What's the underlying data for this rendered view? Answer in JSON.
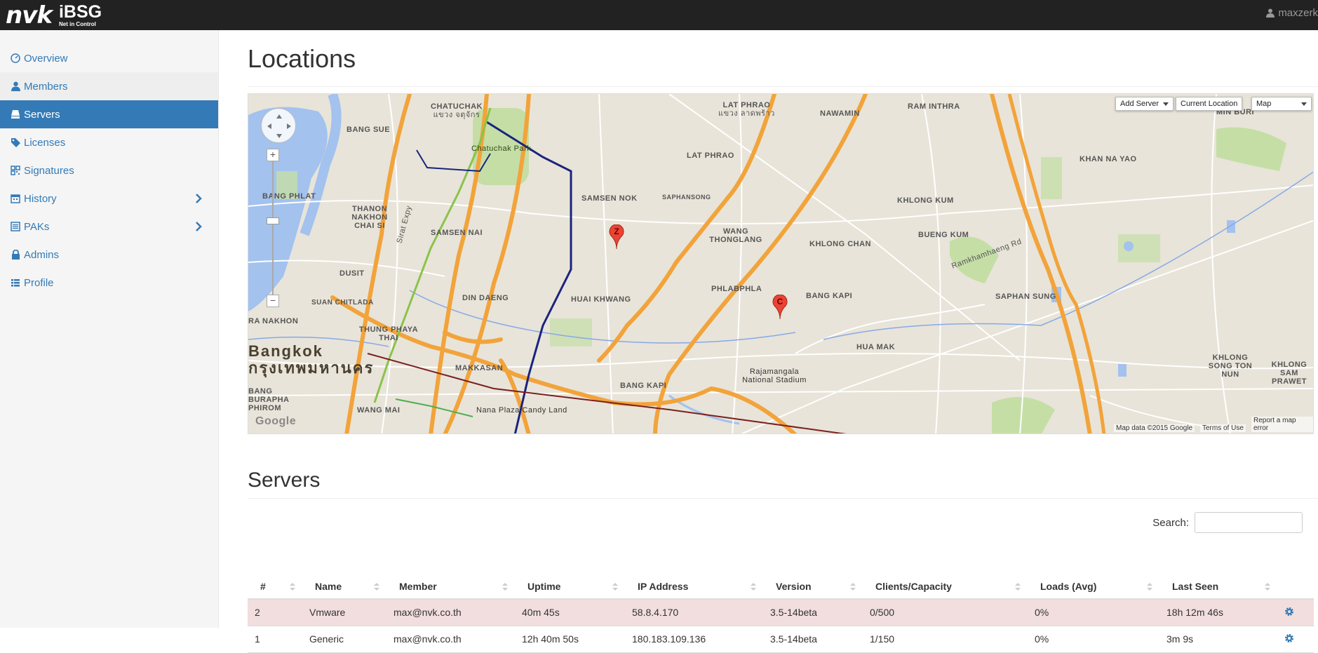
{
  "app": {
    "logo_mark": "nvk",
    "brand": "iBSG",
    "tagline": "Net in Control",
    "user": "maxzerk"
  },
  "sidebar": {
    "items": [
      {
        "label": "Overview",
        "icon": "dashboard-icon"
      },
      {
        "label": "Members",
        "icon": "user-icon"
      },
      {
        "label": "Servers",
        "icon": "server-icon"
      },
      {
        "label": "Licenses",
        "icon": "tags-icon"
      },
      {
        "label": "Signatures",
        "icon": "qrcode-icon"
      },
      {
        "label": "History",
        "icon": "calendar-icon"
      },
      {
        "label": "PAKs",
        "icon": "list-alt-icon"
      },
      {
        "label": "Admins",
        "icon": "lock-icon"
      },
      {
        "label": "Profile",
        "icon": "list-icon"
      }
    ],
    "active": "Servers"
  },
  "locations": {
    "title": "Locations",
    "map": {
      "controls": {
        "add_server": "Add Server",
        "current_location": "Current Location",
        "map_type": "Map"
      },
      "footer": {
        "attribution": "Map data ©2015 Google",
        "terms": "Terms of Use",
        "report": "Report a map error"
      },
      "watermark": "Google",
      "markers": [
        "Z",
        "C"
      ],
      "labels": {
        "chatuchak": "CHATUCHAK",
        "chatuchak_th": "แขวง จตุจักร",
        "lat_phrao": "LAT PHRAO",
        "lat_phrao_th": "แขวง ลาดพร้าว",
        "nawamin": "NAWAMIN",
        "ram_inthra": "RAM INTHRA",
        "min_buri": "MIN BURI",
        "bang_sue": "BANG SUE",
        "chatuchak_park": "Chatuchak Park",
        "lat_phrao_district": "LAT PHRAO",
        "khan_na_yao": "KHAN NA YAO",
        "bang_phlat": "BANG PHLAT",
        "samsen_nok": "SAMSEN NOK",
        "saphansong": "SAPHANSONG",
        "khlong_kum": "KHLONG KUM",
        "thanon_nakhon_chai_si": "THANON NAKHON CHAI SI",
        "samsen_nai": "SAMSEN NAI",
        "wang_thonglang": "WANG THONGLANG",
        "khlong_chan": "KHLONG CHAN",
        "bueng_kum": "BUENG KUM",
        "dusit": "DUSIT",
        "din_daeng": "DIN DAENG",
        "huai_khwang": "HUAI KHWANG",
        "phlabphla": "PHLABPHLA",
        "bang_kapi": "BANG KAPI",
        "saphan_sung": "SAPHAN SUNG",
        "suan_chitlada": "SUAN CHITLADA",
        "ra_nakhon": "RA NAKHON",
        "thung_phaya_thai": "THUNG PHAYA THAI",
        "bangkok": "Bangkok",
        "bangkok_th": "กรุงเทพมหานคร",
        "makkasan": "MAKKASAN",
        "hua_mak": "HUA MAK",
        "rajamangala": "Rajamangala National Stadium",
        "khlong_song_ton_nun": "KHLONG SONG TON NUN",
        "khlong_sam_prawet": "KHLONG SAM PRAWET",
        "bang_kapi_south": "BANG KAPI",
        "nana_plaza": "Nana Plaza Candy Land",
        "wang_mai": "WANG MAI",
        "bang_burapha": "BANG BURAPHA PHIROM",
        "ramkhamhaeng_rd": "Ramkhamhaeng Rd",
        "sirat_expy": "Sirat Expy"
      }
    }
  },
  "servers": {
    "title": "Servers",
    "search_label": "Search:",
    "search_value": "",
    "columns": [
      "#",
      "Name",
      "Member",
      "Uptime",
      "IP Address",
      "Version",
      "Clients/Capacity",
      "Loads (Avg)",
      "Last Seen",
      ""
    ],
    "rows": [
      {
        "id": "2",
        "name": "Vmware",
        "member": "max@nvk.co.th",
        "uptime": "40m 45s",
        "ip": "58.8.4.170",
        "version": "3.5-14beta",
        "clients": "0/500",
        "load": "0%",
        "last_seen": "18h 12m 46s",
        "highlight": true
      },
      {
        "id": "1",
        "name": "Generic",
        "member": "max@nvk.co.th",
        "uptime": "12h 40m 50s",
        "ip": "180.183.109.136",
        "version": "3.5-14beta",
        "clients": "1/150",
        "load": "0%",
        "last_seen": "3m 9s",
        "highlight": false
      }
    ]
  },
  "colors": {
    "topbar": "#222222",
    "accent": "#337ab7",
    "row_highlight": "#f2dede",
    "map_land": "#e8e4d9",
    "map_highway": "#f2a33a",
    "map_water": "#a3c2ee",
    "map_park": "#c5dea6"
  }
}
